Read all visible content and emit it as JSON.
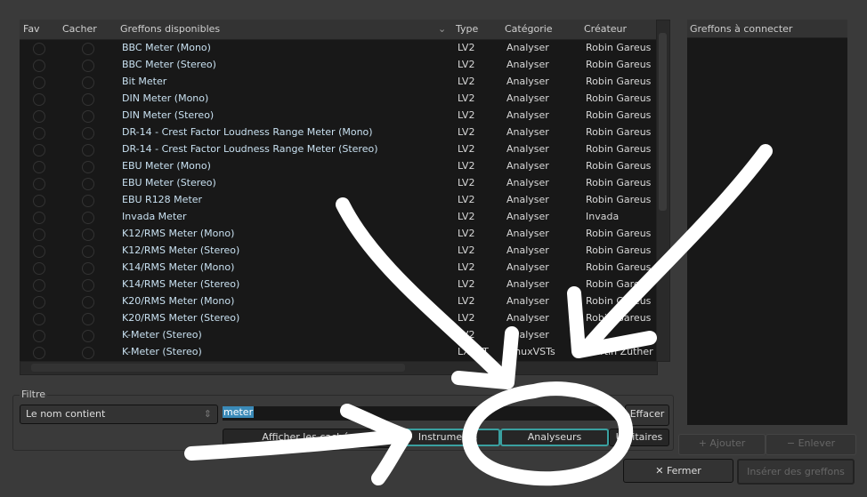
{
  "columns": {
    "fav": "Fav",
    "hide": "Cacher",
    "name": "Greffons disponibles",
    "type": "Type",
    "category": "Catégorie",
    "creator": "Créateur"
  },
  "plugins": [
    {
      "name": "BBC Meter (Mono)",
      "type": "LV2",
      "category": "Analyser",
      "creator": "Robin Gareus"
    },
    {
      "name": "BBC Meter (Stereo)",
      "type": "LV2",
      "category": "Analyser",
      "creator": "Robin Gareus"
    },
    {
      "name": "Bit Meter",
      "type": "LV2",
      "category": "Analyser",
      "creator": "Robin Gareus"
    },
    {
      "name": "DIN Meter (Mono)",
      "type": "LV2",
      "category": "Analyser",
      "creator": "Robin Gareus"
    },
    {
      "name": "DIN Meter (Stereo)",
      "type": "LV2",
      "category": "Analyser",
      "creator": "Robin Gareus"
    },
    {
      "name": "DR-14 - Crest Factor Loudness Range Meter (Mono)",
      "type": "LV2",
      "category": "Analyser",
      "creator": "Robin Gareus"
    },
    {
      "name": "DR-14 - Crest Factor Loudness Range Meter (Stereo)",
      "type": "LV2",
      "category": "Analyser",
      "creator": "Robin Gareus"
    },
    {
      "name": "EBU Meter (Mono)",
      "type": "LV2",
      "category": "Analyser",
      "creator": "Robin Gareus"
    },
    {
      "name": "EBU Meter (Stereo)",
      "type": "LV2",
      "category": "Analyser",
      "creator": "Robin Gareus"
    },
    {
      "name": "EBU R128 Meter",
      "type": "LV2",
      "category": "Analyser",
      "creator": "Robin Gareus"
    },
    {
      "name": "Invada Meter",
      "type": "LV2",
      "category": "Analyser",
      "creator": "Invada"
    },
    {
      "name": "K12/RMS Meter (Mono)",
      "type": "LV2",
      "category": "Analyser",
      "creator": "Robin Gareus"
    },
    {
      "name": "K12/RMS Meter (Stereo)",
      "type": "LV2",
      "category": "Analyser",
      "creator": "Robin Gareus"
    },
    {
      "name": "K14/RMS Meter (Mono)",
      "type": "LV2",
      "category": "Analyser",
      "creator": "Robin Gareus"
    },
    {
      "name": "K14/RMS Meter (Stereo)",
      "type": "LV2",
      "category": "Analyser",
      "creator": "Robin Gareus"
    },
    {
      "name": "K20/RMS Meter (Mono)",
      "type": "LV2",
      "category": "Analyser",
      "creator": "Robin Gareus"
    },
    {
      "name": "K20/RMS Meter (Stereo)",
      "type": "LV2",
      "category": "Analyser",
      "creator": "Robin Gareus"
    },
    {
      "name": "K-Meter (Stereo)",
      "type": "LV2",
      "category": "Analyser",
      "creator": ""
    },
    {
      "name": "K-Meter (Stereo)",
      "type": "LXVST",
      "category": "LinuxVSTs",
      "creator": "Martin Zuther"
    }
  ],
  "right_panel": {
    "title": "Greffons à connecter",
    "add": "Ajouter",
    "remove": "Enlever"
  },
  "filter": {
    "group": "Filtre",
    "mode": "Le nom contient",
    "query": "meter",
    "clear": "Effacer",
    "show_hidden": "Afficher les cachés",
    "instruments": "Instruments",
    "analysers": "Analyseurs",
    "utilities": "Utilitaires"
  },
  "footer": {
    "close": "Fermer",
    "insert": "Insérer des greffons"
  }
}
